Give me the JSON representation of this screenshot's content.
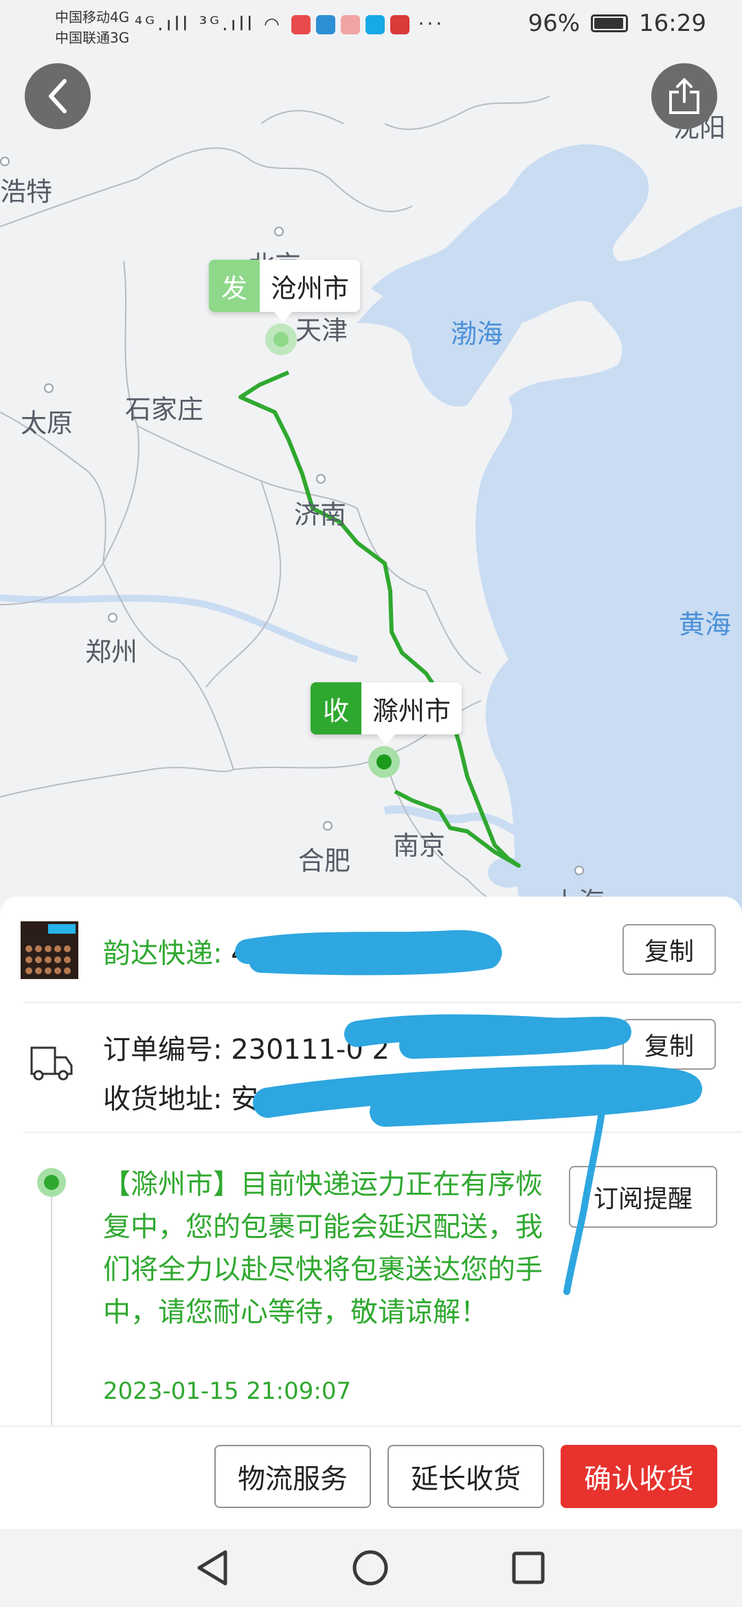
{
  "status_bar": {
    "carrier1": "中国移动4G",
    "carrier2": "中国联通3G",
    "signal_icons": "⁴ᴳ.ıll ³ᴳ.ıll",
    "more": "···",
    "battery": "96%",
    "time": "16:29"
  },
  "map": {
    "cities": {
      "shenyang": "沈阳",
      "haote": "浩特",
      "beijing": "北京",
      "tianjin": "天津",
      "shijiazhuang": "石家庄",
      "taiyuan": "太原",
      "jinan": "济南",
      "zhengzhou": "郑州",
      "hefei": "合肥",
      "nanjing": "南京",
      "shanghai": "上海"
    },
    "seas": {
      "bohai": "渤海",
      "huanghai": "黄海"
    },
    "origin": {
      "kind": "发",
      "city": "沧州市"
    },
    "destination": {
      "kind": "收",
      "city": "滁州市"
    },
    "route_color": "#2fa82f"
  },
  "sheet": {
    "courier_name": "韵达快递: ",
    "courier_number": "46                    8",
    "copy_label": "复制",
    "order_label": "订单编号: ",
    "order_value": "230111-0                      2",
    "address_label": "收货地址: ",
    "address_value": "安",
    "subscribe_label": "订阅提醒",
    "track_text": "【滁州市】目前快递运力正在有序恢复中，您的包裹可能会延迟配送，我们将全力以赴尽快将包裹送达您的手中，请您耐心等待，敬请谅解！",
    "track_time": "2023-01-15 21:09:07"
  },
  "actions": {
    "logistics": "物流服务",
    "extend": "延长收货",
    "confirm": "确认收货"
  },
  "colors": {
    "accent_green": "#2fa82f",
    "confirm_red": "#e8322d",
    "scribble_blue": "#2ea6e0"
  },
  "icons": {
    "back": "back-icon",
    "share": "share-icon",
    "truck": "truck-icon",
    "nav_back": "nav-back-icon",
    "nav_home": "nav-home-icon",
    "nav_recents": "nav-recents-icon"
  }
}
